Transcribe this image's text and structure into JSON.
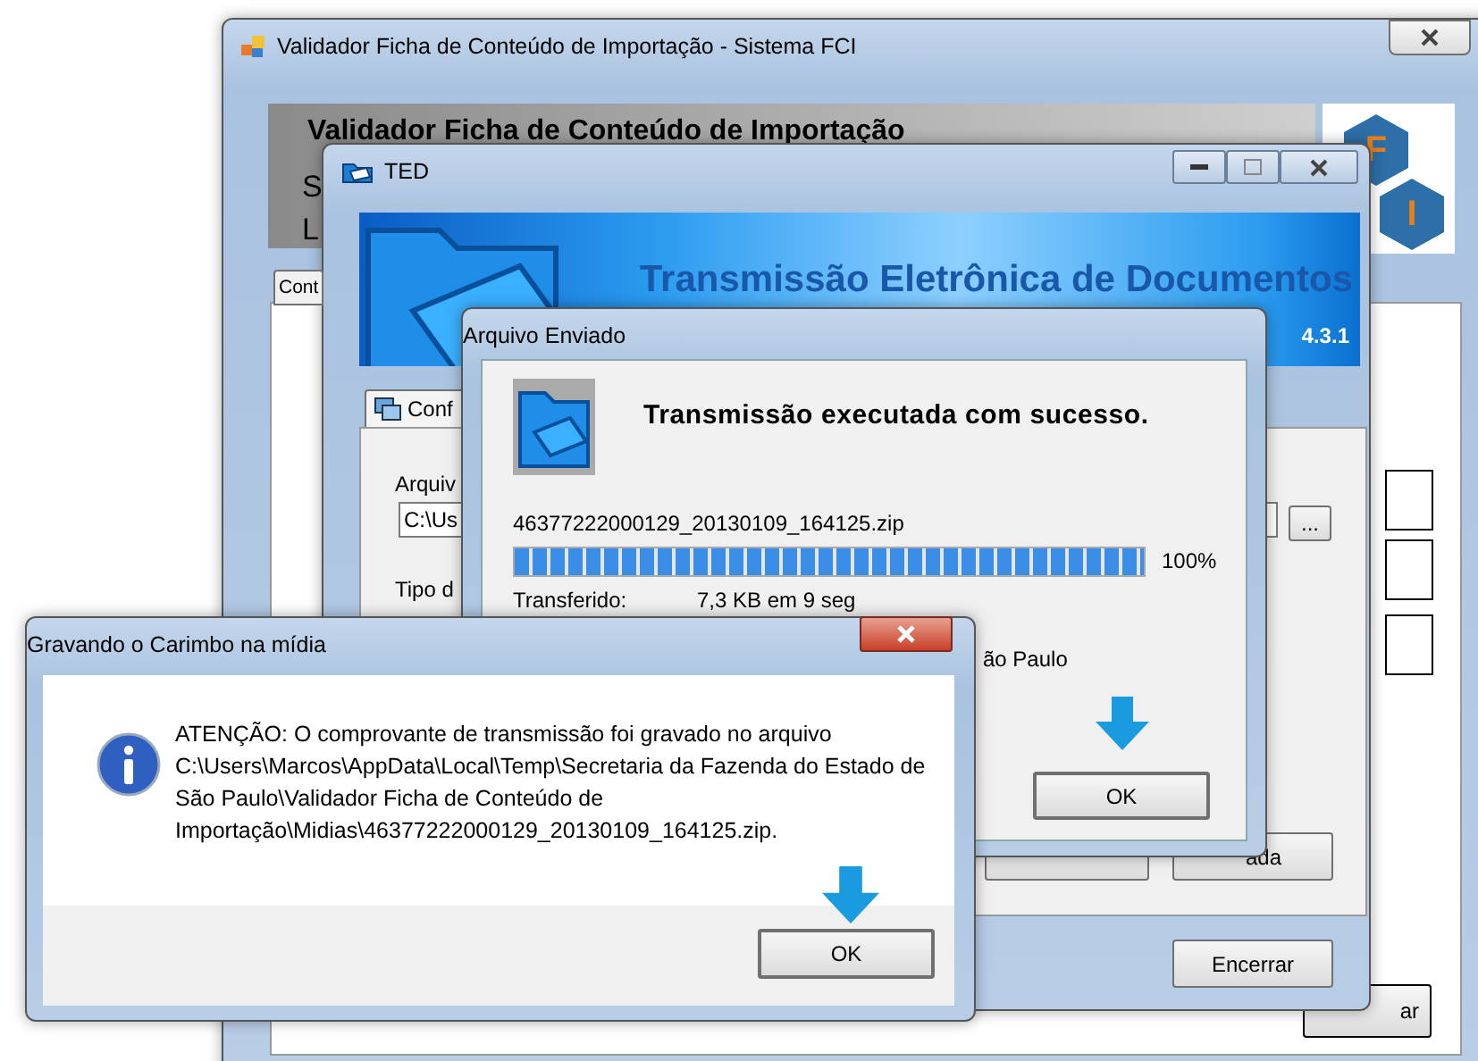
{
  "main_window": {
    "title": "Validador Ficha de Conteúdo de Importação - Sistema FCI",
    "header_title": "Validador Ficha de Conteúdo de Importação",
    "header_line_2": "S",
    "header_line_3": "L",
    "logo_letters": [
      "F",
      "I"
    ],
    "tab": "Cont",
    "button": "ar"
  },
  "ted_window": {
    "title": "TED",
    "banner_title": "Transmissão Eletrônica de Documentos",
    "version": "4.3.1",
    "tab": "Conf",
    "file_label": "Arquiv",
    "file_path": "C:\\Us",
    "browse_button": "...",
    "type_label": "Tipo d",
    "button": "ada",
    "close_button": "Encerrar"
  },
  "sent_dialog": {
    "title": "Arquivo Enviado",
    "message": "Transmissão executada com sucesso.",
    "file_name": "46377222000129_20130109_164125.zip",
    "progress": {
      "level": 1,
      "reading": "100%"
    },
    "transferred_label": "Transferido:",
    "transferred_value": "7,3 KB em 9 seg",
    "location_text": "ão Paulo",
    "ok_button": "OK"
  },
  "media_dialog": {
    "title": "Gravando o Carimbo na mídia",
    "message": "ATENÇÃO: O comprovante de transmissão foi gravado no arquivo C:\\Users\\Marcos\\AppData\\Local\\Temp\\Secretaria da Fazenda do Estado de São Paulo\\Validador Ficha de Conteúdo de Importação\\Midias\\46377222000129_20130109_164125.zip.",
    "ok_button": "OK"
  }
}
